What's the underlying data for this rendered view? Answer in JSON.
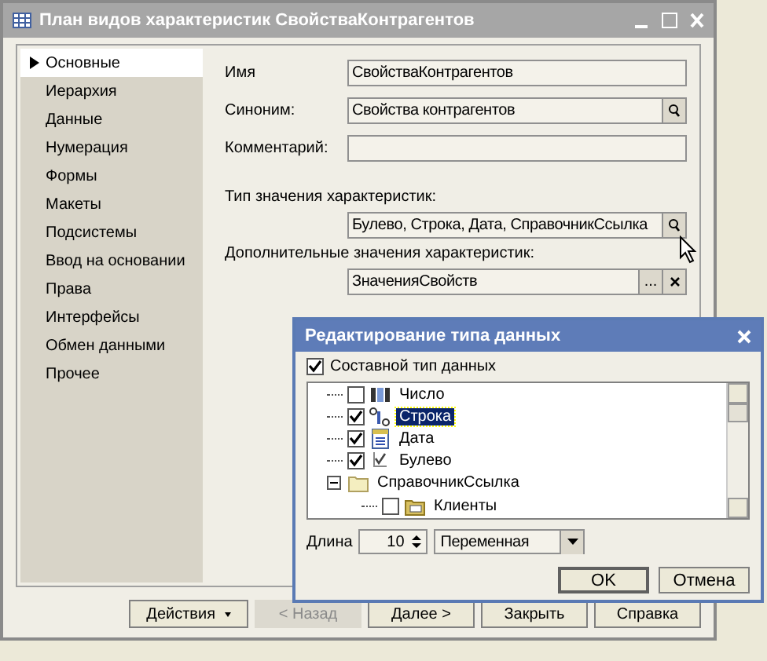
{
  "window": {
    "title": "План видов характеристик СвойстваКонтрагентов"
  },
  "sidebar": {
    "items": [
      {
        "label": "Основные",
        "selected": true
      },
      {
        "label": "Иерархия",
        "selected": false
      },
      {
        "label": "Данные",
        "selected": false
      },
      {
        "label": "Нумерация",
        "selected": false
      },
      {
        "label": "Формы",
        "selected": false
      },
      {
        "label": "Макеты",
        "selected": false
      },
      {
        "label": "Подсистемы",
        "selected": false
      },
      {
        "label": "Ввод на основании",
        "selected": false
      },
      {
        "label": "Права",
        "selected": false
      },
      {
        "label": "Интерфейсы",
        "selected": false
      },
      {
        "label": "Обмен данными",
        "selected": false
      },
      {
        "label": "Прочее",
        "selected": false
      }
    ]
  },
  "form": {
    "fields": [
      {
        "kind": "inline",
        "label": "Имя",
        "value": "СвойстваКонтрагентов"
      },
      {
        "kind": "inline",
        "label": "Синоним:",
        "value": "Свойства контрагентов",
        "buttons": [
          {
            "kind": "search"
          }
        ]
      },
      {
        "kind": "inline",
        "label": "Комментарий:"
      },
      {
        "kind": "stacked",
        "label": "Тип значения характеристик:",
        "value": "Булево, Строка, Дата, СправочникСсылка",
        "buttons": [
          {
            "kind": "search"
          }
        ]
      },
      {
        "kind": "stacked",
        "label": "Дополнительные значения характеристик:",
        "value": "ЗначенияСвойств",
        "buttons": [
          {
            "kind": "text",
            "text": "..."
          },
          {
            "kind": "clear"
          }
        ]
      }
    ]
  },
  "buttons": [
    {
      "label": "Действия",
      "kind": "menu",
      "disabled": false
    },
    {
      "label": "< Назад",
      "kind": "plain",
      "disabled": true
    },
    {
      "label": "Далее >",
      "kind": "plain",
      "disabled": false
    },
    {
      "label": "Закрыть",
      "kind": "plain",
      "disabled": false
    },
    {
      "label": "Справка",
      "kind": "plain",
      "disabled": false
    }
  ],
  "dialog": {
    "title": "Редактирование типа данных",
    "composite": {
      "label": "Составной тип данных",
      "checked": true
    },
    "tree": [
      {
        "label": "Число",
        "kind": "number",
        "checked": false,
        "selected": false
      },
      {
        "label": "Строка",
        "kind": "string",
        "checked": true,
        "selected": true
      },
      {
        "label": "Дата",
        "kind": "date",
        "checked": true,
        "selected": false
      },
      {
        "label": "Булево",
        "kind": "boolean",
        "checked": true,
        "selected": false
      },
      {
        "label": "СправочникСсылка",
        "kind": "folder",
        "expanded": true,
        "selected": false,
        "children": [
          {
            "label": "Клиенты",
            "kind": "catalog",
            "checked": false,
            "selected": false
          }
        ]
      }
    ],
    "length": {
      "label": "Длина",
      "value": "10"
    },
    "mode": {
      "value": "Переменная"
    },
    "buttons": [
      {
        "label": "OK",
        "default": true
      },
      {
        "label": "Отмена",
        "default": false
      }
    ]
  }
}
